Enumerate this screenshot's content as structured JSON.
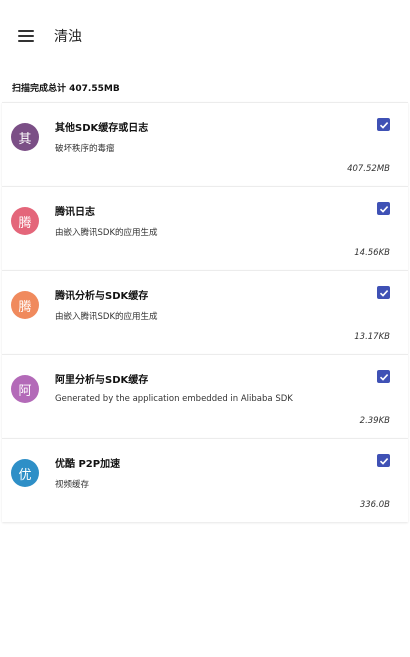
{
  "appbar": {
    "title": "清浊",
    "menu_icon": "menu-icon"
  },
  "summary": {
    "text": "扫描完成总计 407.55MB"
  },
  "items": [
    {
      "avatar_char": "其",
      "avatar_color": "#7b4f86",
      "title": "其他SDK缓存或日志",
      "desc": "破坏秩序的毒瘤",
      "size": "407.52MB",
      "checked": true
    },
    {
      "avatar_char": "腾",
      "avatar_color": "#e4667a",
      "title": "腾讯日志",
      "desc": "由嵌入腾讯SDK的应用生成",
      "size": "14.56KB",
      "checked": true
    },
    {
      "avatar_char": "腾",
      "avatar_color": "#f08a5d",
      "title": "腾讯分析与SDK缓存",
      "desc": "由嵌入腾讯SDK的应用生成",
      "size": "13.17KB",
      "checked": true
    },
    {
      "avatar_char": "阿",
      "avatar_color": "#b36ab8",
      "title": "阿里分析与SDK缓存",
      "desc": "Generated by the application embedded in Alibaba SDK",
      "size": "2.39KB",
      "checked": true
    },
    {
      "avatar_char": "优",
      "avatar_color": "#2e8fc7",
      "title": "优酷 P2P加速",
      "desc": "视频缓存",
      "size": "336.0B",
      "checked": true
    }
  ]
}
